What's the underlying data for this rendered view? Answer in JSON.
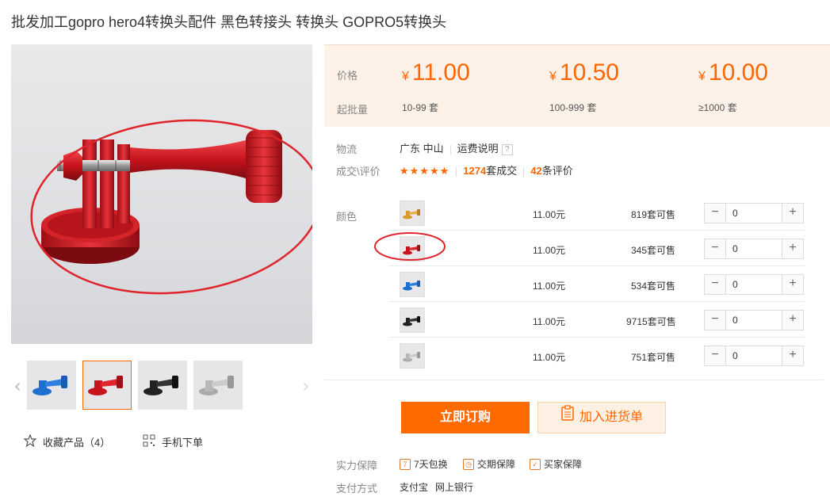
{
  "product": {
    "title": "批发加工gopro hero4转换头配件 黑色转接头 转换头 GOPRO5转换头"
  },
  "prices": {
    "price_label": "价格",
    "moq_label": "起批量",
    "currency": "¥",
    "tiers": [
      {
        "price": "11.00",
        "range": "10-99 套"
      },
      {
        "price": "10.50",
        "range": "100-999 套"
      },
      {
        "price": "10.00",
        "range": "≥1000 套"
      }
    ]
  },
  "logistics": {
    "label": "物流",
    "location": "广东 中山",
    "shipping_link": "运费说明",
    "help": "?"
  },
  "reviews": {
    "label": "成交\\评价",
    "stars": "★★★★★",
    "deals_count": "1274",
    "deals_suffix": "套成交",
    "review_count": "42",
    "review_suffix": "条评价"
  },
  "variants": {
    "label": "颜色",
    "rows": [
      {
        "color": "gold",
        "price": "11.00元",
        "stock": "819套可售",
        "qty": "0"
      },
      {
        "color": "red",
        "price": "11.00元",
        "stock": "345套可售",
        "qty": "0"
      },
      {
        "color": "blue",
        "price": "11.00元",
        "stock": "534套可售",
        "qty": "0"
      },
      {
        "color": "black",
        "price": "11.00元",
        "stock": "9715套可售",
        "qty": "0"
      },
      {
        "color": "silver",
        "price": "11.00元",
        "stock": "751套可售",
        "qty": "0"
      }
    ]
  },
  "actions": {
    "buy_now": "立即订购",
    "add_to_cart": "加入进货单"
  },
  "left_actions": {
    "favorite": "收藏产品（4）",
    "mobile_order": "手机下单"
  },
  "guarantee": {
    "label": "实力保障",
    "items": [
      "7天包换",
      "交期保障",
      "买家保障"
    ]
  },
  "payment": {
    "label": "支付方式",
    "methods": [
      "支付宝",
      "网上银行"
    ]
  },
  "colors": {
    "accent": "#ff6a00",
    "price_bg": "#fdf1e8",
    "red_metal": "#c8141c",
    "blue_metal": "#1e6fd0",
    "gold_metal": "#d89a2a",
    "black_metal": "#222222",
    "silver_metal": "#b8b8b8",
    "annotation": "#e0242c"
  }
}
